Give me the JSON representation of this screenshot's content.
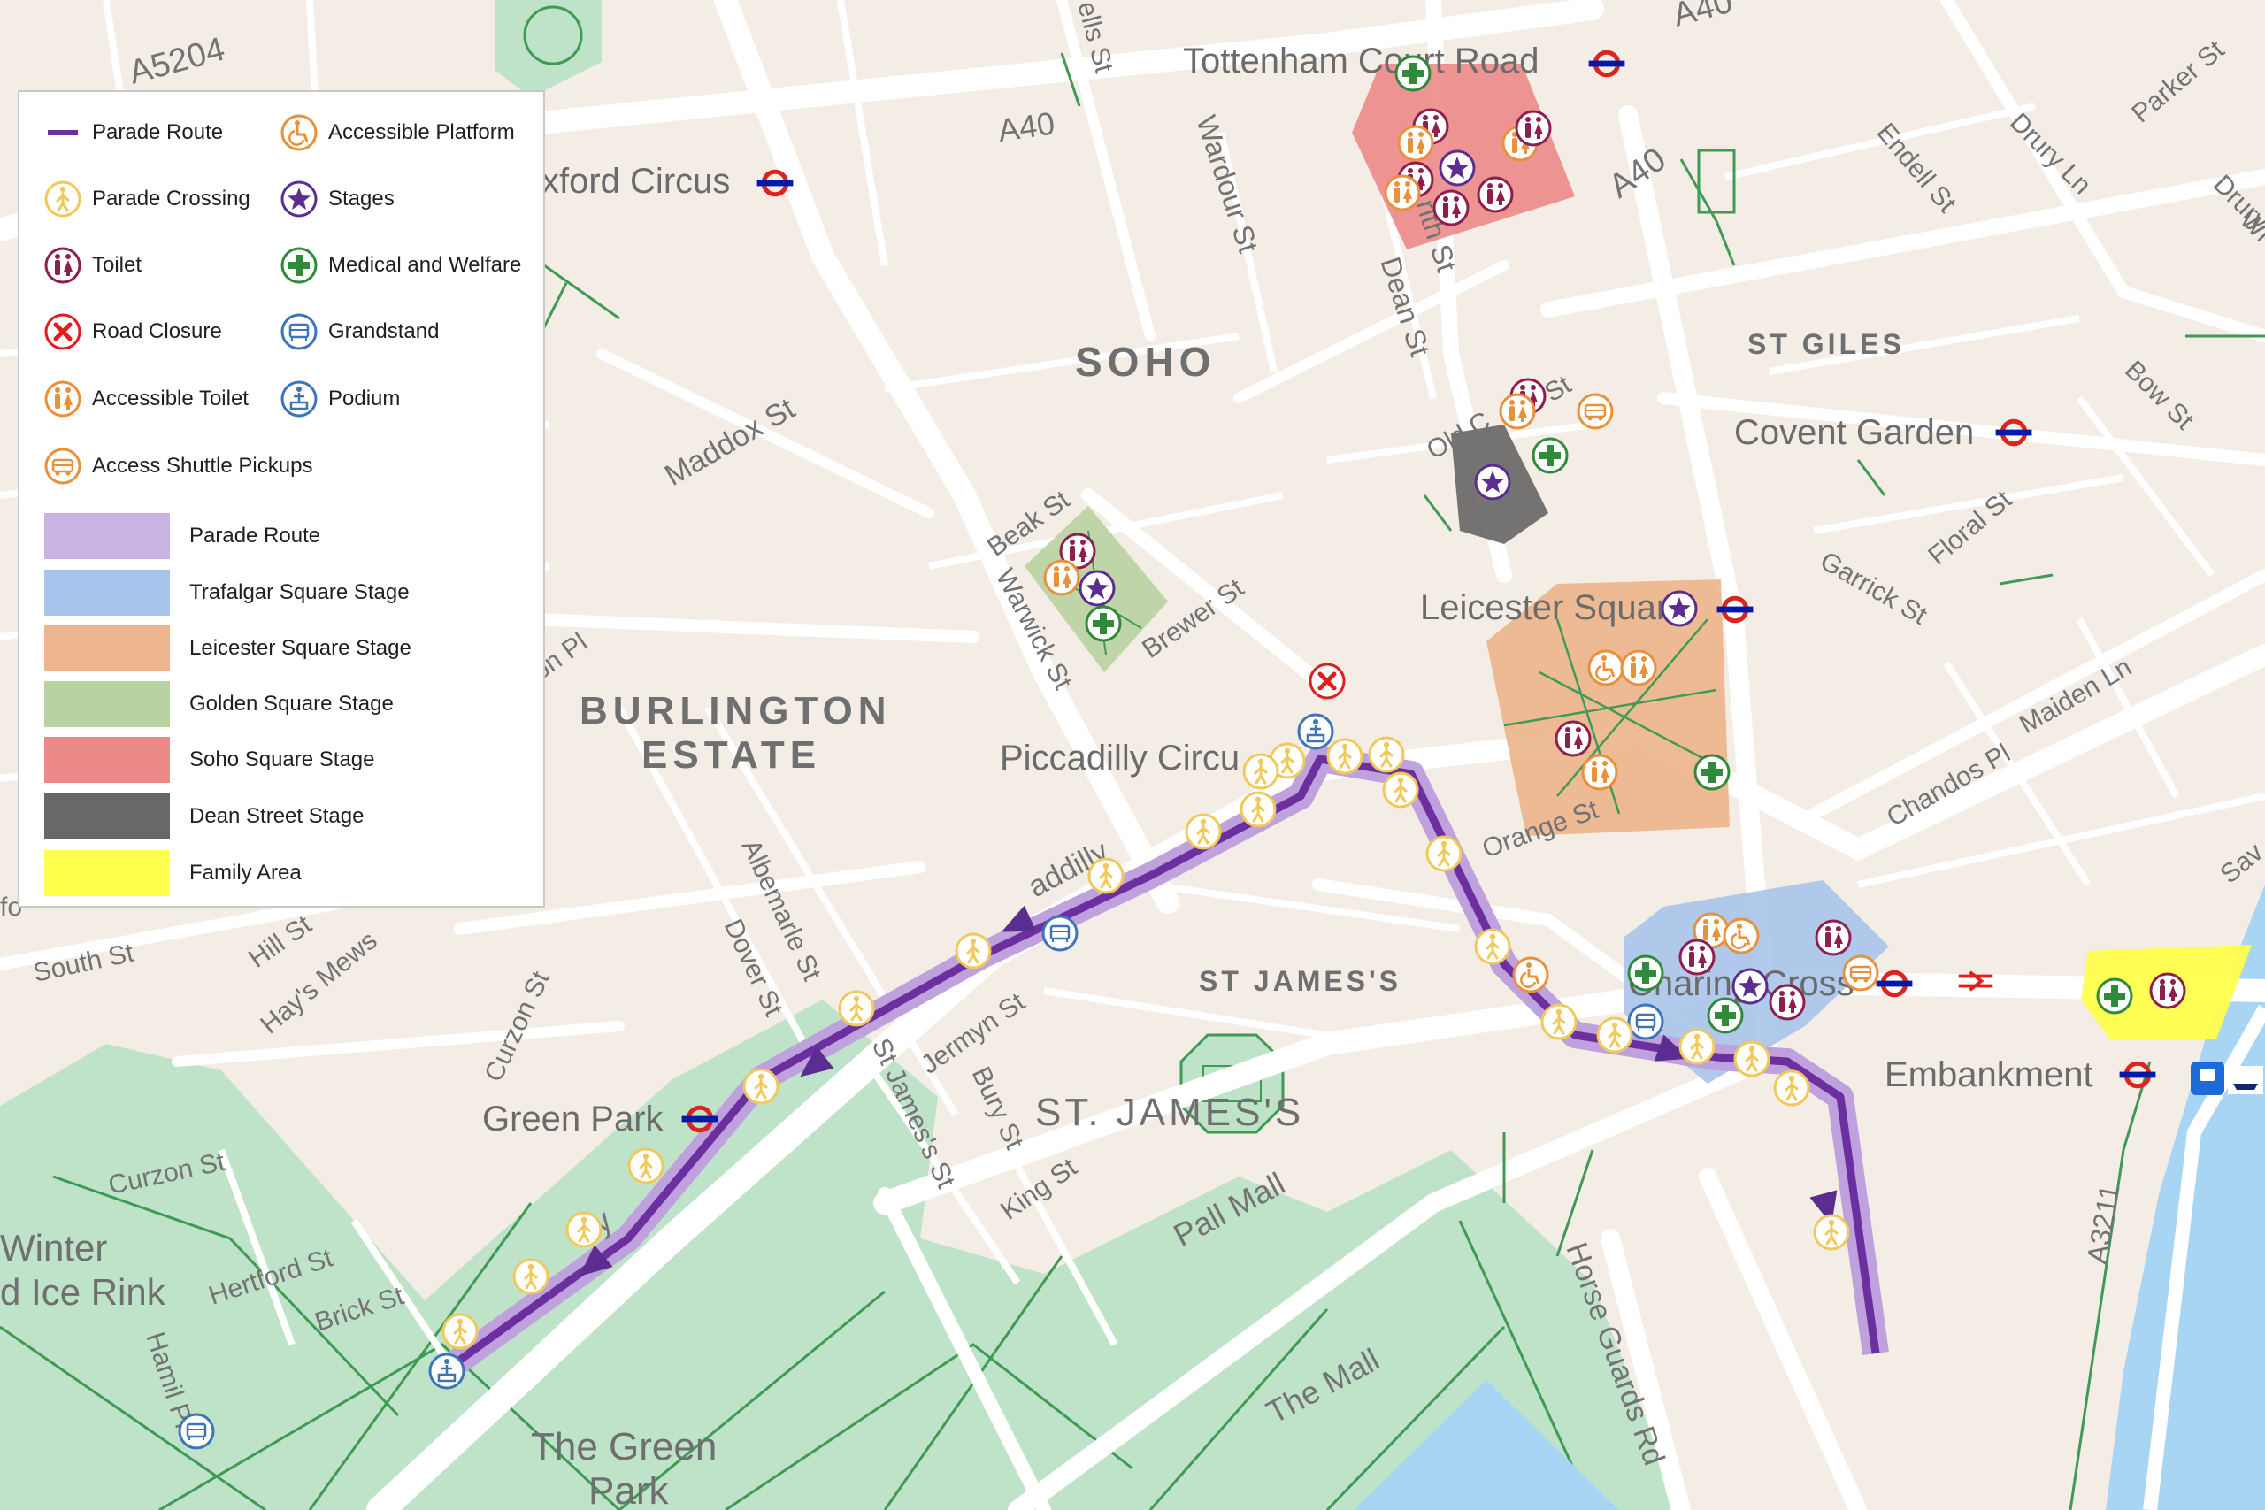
{
  "colors": {
    "land": "#f4ede6",
    "block": "#ede4da",
    "road": "#ffffff",
    "park": "#bfe3c8",
    "park_line": "#3f9a55",
    "water": "#a9d5f5",
    "label": "#737373",
    "route": "#6b2fa0",
    "route_halo": "#bfa2dd",
    "tube_red": "#dc241f",
    "tube_blue": "#0019a8",
    "rail_red": "#e32017"
  },
  "legend": {
    "icons": [
      {
        "icon": "parade-route-line",
        "label": "Parade Route"
      },
      {
        "icon": "accessible-platform-icon",
        "label": "Accessible Platform"
      },
      {
        "icon": "parade-crossing-icon",
        "label": "Parade Crossing"
      },
      {
        "icon": "stage-star-icon",
        "label": "Stages"
      },
      {
        "icon": "toilet-icon",
        "label": "Toilet"
      },
      {
        "icon": "medical-cross-icon",
        "label": "Medical and Welfare"
      },
      {
        "icon": "road-closure-icon",
        "label": "Road Closure"
      },
      {
        "icon": "grandstand-icon",
        "label": "Grandstand"
      },
      {
        "icon": "accessible-toilet-icon",
        "label": "Accessible Toilet"
      },
      {
        "icon": "podium-icon",
        "label": "Podium"
      },
      {
        "icon": "shuttle-bus-icon",
        "label": "Access Shuttle Pickups"
      }
    ],
    "swatches": [
      {
        "label": "Parade Route",
        "color": "#c9b3e3"
      },
      {
        "label": "Trafalgar Square Stage",
        "color": "#a9c4ea"
      },
      {
        "label": "Leicester Square Stage",
        "color": "#ecb58d"
      },
      {
        "label": "Golden Square Stage",
        "color": "#b9d2a1"
      },
      {
        "label": "Soho Square Stage",
        "color": "#ec8a8a"
      },
      {
        "label": "Dean Street Stage",
        "color": "#686868"
      },
      {
        "label": "Family Area",
        "color": "#ffff4d"
      }
    ]
  },
  "map": {
    "districts": [
      "SOHO",
      "BURLINGTON",
      "ESTATE",
      "ST GILES",
      "ST JAMES'S",
      "ST. JAMES'S"
    ],
    "stations": [
      "Tottenham Court Road",
      "xford Circus",
      "Covent Garden",
      "Leicester Square",
      "Piccadilly Circu",
      "Green Park",
      "Charing Cross",
      "Embankment"
    ],
    "streets": [
      "A5204",
      "A40",
      "A40",
      "A40",
      "ells St",
      "Wardour St",
      "Dean St",
      "rith St",
      "Drury Ln",
      "Drury Ln",
      "Parker St",
      "Endell St",
      "Wi",
      "Old C",
      "ton St",
      "Maddox St",
      "Beak St",
      "Warwick St",
      "Brewer St",
      "Bow St",
      "Floral St",
      "Garrick St",
      "Chandos Pl",
      "Maiden Ln",
      "Orange St",
      "on Pl",
      "South St",
      "Hill St",
      "Hay's Mews",
      "Curzon St",
      "Albemarle St",
      "Dover St",
      "Jermyn St",
      "St James's St",
      "Bury St",
      "King St",
      "Pall Mall",
      "The Mall",
      "Horse Guards Rd",
      "A3211",
      "Hertford St",
      "Brick St",
      "Curzon St",
      "Hamil Pl",
      "Sav",
      "addilly",
      "illy",
      "fo"
    ],
    "places": [
      "The Green",
      "Park",
      "Winter",
      "d Ice Rink"
    ]
  }
}
